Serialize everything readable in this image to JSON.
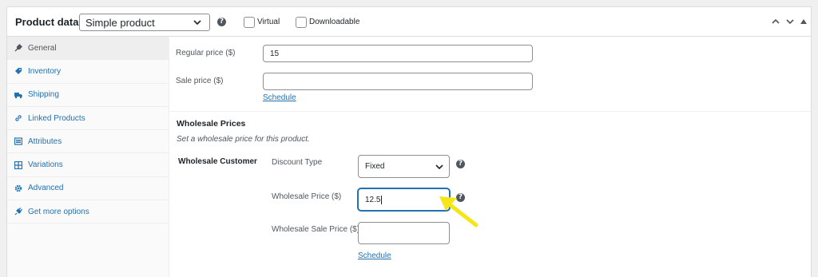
{
  "header": {
    "title": "Product data —",
    "product_type": "Simple product",
    "virtual_label": "Virtual",
    "downloadable_label": "Downloadable"
  },
  "sidebar": {
    "items": [
      {
        "label": "General",
        "icon": "wrench-icon"
      },
      {
        "label": "Inventory",
        "icon": "tag-icon"
      },
      {
        "label": "Shipping",
        "icon": "truck-icon"
      },
      {
        "label": "Linked Products",
        "icon": "link-icon"
      },
      {
        "label": "Attributes",
        "icon": "list-icon"
      },
      {
        "label": "Variations",
        "icon": "grid-icon"
      },
      {
        "label": "Advanced",
        "icon": "gear-icon"
      },
      {
        "label": "Get more options",
        "icon": "plugin-icon"
      }
    ]
  },
  "general": {
    "regular_price_label": "Regular price ($)",
    "regular_price_value": "15",
    "sale_price_label": "Sale price ($)",
    "sale_price_value": "",
    "schedule_link": "Schedule"
  },
  "wholesale": {
    "heading": "Wholesale Prices",
    "description": "Set a wholesale price for this product.",
    "role": "Wholesale Customer",
    "discount_type_label": "Discount Type",
    "discount_type_value": "Fixed",
    "price_label": "Wholesale Price ($)",
    "price_value": "12.5",
    "sale_price_label": "Wholesale Sale Price ($)",
    "sale_price_value": "",
    "schedule_link": "Schedule"
  },
  "colors": {
    "accent": "#2271b1",
    "annotation_arrow": "#f5e61a"
  }
}
